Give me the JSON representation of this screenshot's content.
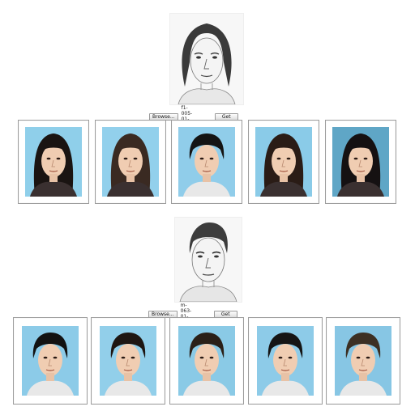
{
  "queries": [
    {
      "browse_label": "Browse...",
      "filename": "f1-005-01-sz1.jpg",
      "similar_label": "Get Similar",
      "sketch_icon": "female-face-sketch",
      "results": [
        {
          "icon": "female-face-photo",
          "bg": "#8fcfea",
          "hair": "#1a1412"
        },
        {
          "icon": "female-face-photo",
          "bg": "#92d0ec",
          "hair": "#3a2a22"
        },
        {
          "icon": "male-face-photo",
          "bg": "#90cdea",
          "hair": "#141414"
        },
        {
          "icon": "female-face-photo",
          "bg": "#8acbe8",
          "hair": "#2a1c16"
        },
        {
          "icon": "female-face-photo",
          "bg": "#5fa6c6",
          "hair": "#151112"
        }
      ]
    },
    {
      "browse_label": "Browse...",
      "filename": "m-063-01-sz1.jpg",
      "similar_label": "Get Similar",
      "sketch_icon": "male-face-sketch",
      "results": [
        {
          "icon": "male-face-photo",
          "bg": "#8ccbe8",
          "hair": "#121212"
        },
        {
          "icon": "male-face-photo",
          "bg": "#92cfea",
          "hair": "#1e1612"
        },
        {
          "icon": "male-face-photo",
          "bg": "#8acae6",
          "hair": "#2a2018"
        },
        {
          "icon": "male-face-photo",
          "bg": "#8dcbe8",
          "hair": "#151515"
        },
        {
          "icon": "male-face-photo",
          "bg": "#87c6e4",
          "hair": "#3c3024"
        }
      ]
    }
  ]
}
